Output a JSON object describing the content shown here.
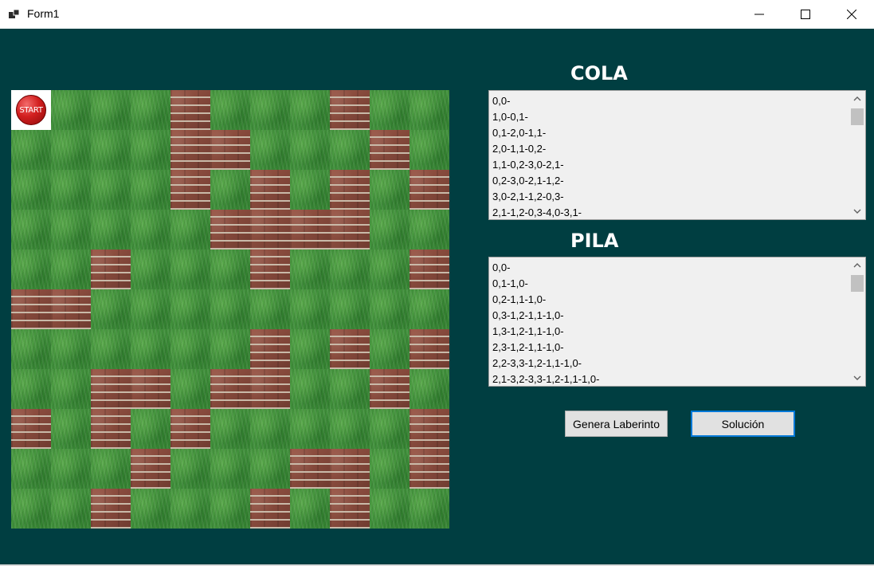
{
  "window": {
    "title": "Form1",
    "minimize_icon": "minimize-icon",
    "maximize_icon": "maximize-icon",
    "close_icon": "close-icon"
  },
  "colors": {
    "form_background": "#003e41",
    "heading_text": "#ffffff",
    "listbox_background": "#f0f0f0",
    "button_background": "#e1e1e1",
    "focus_border": "#0078d7"
  },
  "maze": {
    "rows": 11,
    "cols": 11,
    "start_label": "START",
    "legend": {
      "S": "start",
      "G": "grass",
      "B": "brick"
    },
    "grid": [
      "SGGGBGGGBGG",
      "GGGGBBGGGBG",
      "GGGGBGBGBGB",
      "GGGGGBBBBGG",
      "GGBGGGBGGGB",
      "BBGGGGGGGGG",
      "GGGGGGBGBGB",
      "GGBBGBBGGBG",
      "BGBGBGGGGGB",
      "GGGBGGGBBGB",
      "GGBGGGBGBGG"
    ]
  },
  "cola": {
    "title": "COLA",
    "items": [
      "0,0-",
      "1,0-0,1-",
      "0,1-2,0-1,1-",
      "2,0-1,1-0,2-",
      "1,1-0,2-3,0-2,1-",
      "0,2-3,0-2,1-1,2-",
      "3,0-2,1-1,2-0,3-",
      "2,1-1,2-0,3-4,0-3,1-"
    ]
  },
  "pila": {
    "title": "PILA",
    "items": [
      "0,0-",
      "0,1-1,0-",
      "0,2-1,1-1,0-",
      "0,3-1,2-1,1-1,0-",
      "1,3-1,2-1,1-1,0-",
      "2,3-1,2-1,1-1,0-",
      "2,2-3,3-1,2-1,1-1,0-",
      "2,1-3,2-3,3-1,2-1,1-1,0-"
    ]
  },
  "buttons": {
    "genera": "Genera Laberinto",
    "solucion": "Solución"
  }
}
